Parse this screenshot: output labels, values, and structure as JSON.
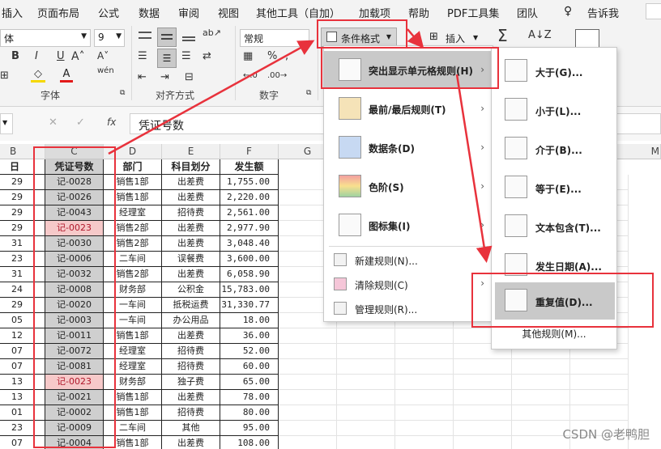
{
  "menubar": {
    "items": [
      "插入",
      "页面布局",
      "公式",
      "数据",
      "审阅",
      "视图",
      "其他工具（自加）",
      "加载项",
      "帮助",
      "PDF工具集",
      "团队",
      "告诉我"
    ]
  },
  "ribbon": {
    "font_name": "体",
    "font_size": "9",
    "number_format": "常规",
    "group_font": "字体",
    "group_align": "对齐方式",
    "group_number": "数字",
    "conditional_format_button": "条件格式",
    "insert_button": "插入",
    "bold": "B",
    "italic": "I",
    "underline": "U",
    "sum_symbol": "Σ",
    "wen_label": "wén"
  },
  "formula_bar": {
    "fx": "fx",
    "content": "凭证号数"
  },
  "columns": [
    "B",
    "C",
    "D",
    "E",
    "F",
    "G",
    "M"
  ],
  "table": {
    "headers": [
      "日",
      "凭证号数",
      "部门",
      "科目划分",
      "发生额"
    ],
    "rows": [
      {
        "day": "29",
        "voucher": "记-0028",
        "dept": "销售1部",
        "subject": "出差费",
        "amount": "1,755.00",
        "dup": false
      },
      {
        "day": "29",
        "voucher": "记-0026",
        "dept": "销售1部",
        "subject": "出差费",
        "amount": "2,220.00",
        "dup": false
      },
      {
        "day": "29",
        "voucher": "记-0043",
        "dept": "经理室",
        "subject": "招待费",
        "amount": "2,561.00",
        "dup": false
      },
      {
        "day": "29",
        "voucher": "记-0023",
        "dept": "销售2部",
        "subject": "出差费",
        "amount": "2,977.90",
        "dup": true
      },
      {
        "day": "31",
        "voucher": "记-0030",
        "dept": "销售2部",
        "subject": "出差费",
        "amount": "3,048.40",
        "dup": false
      },
      {
        "day": "23",
        "voucher": "记-0006",
        "dept": "二车间",
        "subject": "误餐费",
        "amount": "3,600.00",
        "dup": false
      },
      {
        "day": "31",
        "voucher": "记-0032",
        "dept": "销售2部",
        "subject": "出差费",
        "amount": "6,058.90",
        "dup": false
      },
      {
        "day": "24",
        "voucher": "记-0008",
        "dept": "财务部",
        "subject": "公积金",
        "amount": "15,783.00",
        "dup": false
      },
      {
        "day": "29",
        "voucher": "记-0020",
        "dept": "一车间",
        "subject": "抵税运费",
        "amount": "31,330.77",
        "dup": false
      },
      {
        "day": "05",
        "voucher": "记-0003",
        "dept": "一车间",
        "subject": "办公用品",
        "amount": "18.00",
        "dup": false
      },
      {
        "day": "12",
        "voucher": "记-0011",
        "dept": "销售1部",
        "subject": "出差费",
        "amount": "36.00",
        "dup": false
      },
      {
        "day": "07",
        "voucher": "记-0072",
        "dept": "经理室",
        "subject": "招待费",
        "amount": "52.00",
        "dup": false
      },
      {
        "day": "07",
        "voucher": "记-0081",
        "dept": "经理室",
        "subject": "招待费",
        "amount": "60.00",
        "dup": false
      },
      {
        "day": "13",
        "voucher": "记-0023",
        "dept": "财务部",
        "subject": "独子费",
        "amount": "65.00",
        "dup": true
      },
      {
        "day": "13",
        "voucher": "记-0021",
        "dept": "销售1部",
        "subject": "出差费",
        "amount": "78.00",
        "dup": false
      },
      {
        "day": "01",
        "voucher": "记-0002",
        "dept": "销售1部",
        "subject": "招待费",
        "amount": "80.00",
        "dup": false
      },
      {
        "day": "23",
        "voucher": "记-0009",
        "dept": "二车间",
        "subject": "其他",
        "amount": "95.00",
        "dup": false
      },
      {
        "day": "07",
        "voucher": "记-0004",
        "dept": "销售1部",
        "subject": "出差费",
        "amount": "108.00",
        "dup": false
      }
    ]
  },
  "cf_menu": {
    "items": [
      {
        "label": "突出显示单元格规则(H)",
        "icon": "highlight-rules-icon"
      },
      {
        "label": "最前/最后规则(T)",
        "icon": "top-bottom-icon"
      },
      {
        "label": "数据条(D)",
        "icon": "data-bars-icon"
      },
      {
        "label": "色阶(S)",
        "icon": "color-scales-icon"
      },
      {
        "label": "图标集(I)",
        "icon": "icon-sets-icon"
      }
    ],
    "small_items": [
      "新建规则(N)...",
      "清除规则(C)",
      "管理规则(R)..."
    ]
  },
  "submenu": {
    "items": [
      "大于(G)...",
      "小于(L)...",
      "介于(B)...",
      "等于(E)...",
      "文本包含(T)...",
      "发生日期(A)...",
      "重复值(D)..."
    ],
    "more": "其他规则(M)..."
  },
  "watermark": "CSDN @老鸭胆",
  "colors": {
    "red_highlight": "#e8323c",
    "duplicate_fill": "#f6c9c9",
    "duplicate_text": "#b0192c",
    "selected_column_fill": "#cfcfcf"
  }
}
